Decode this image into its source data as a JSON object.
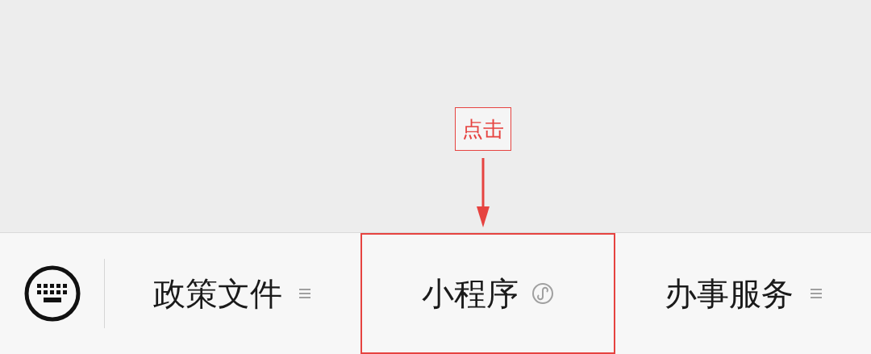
{
  "annotation": {
    "label": "点击"
  },
  "menu": {
    "items": [
      {
        "label": "政策文件",
        "kind": "submenu",
        "highlighted": false
      },
      {
        "label": "小程序",
        "kind": "miniprogram",
        "highlighted": true
      },
      {
        "label": "办事服务",
        "kind": "submenu",
        "highlighted": false
      }
    ]
  }
}
